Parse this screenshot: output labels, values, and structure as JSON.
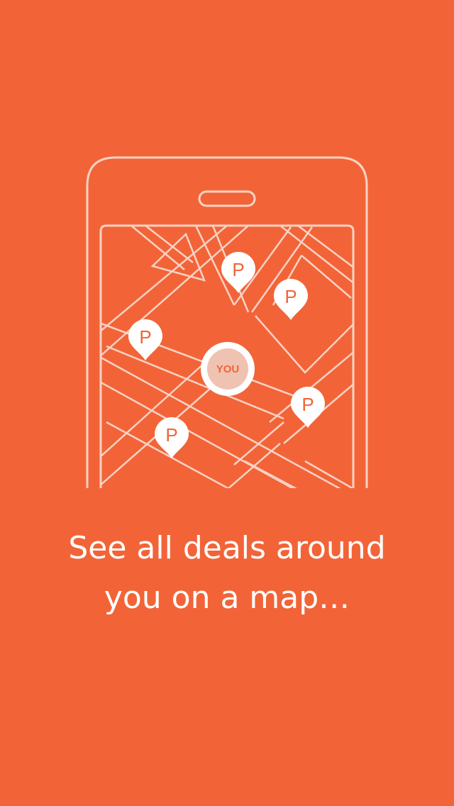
{
  "onboarding": {
    "caption_line1": "See all deals around",
    "caption_line2": "you on a map…"
  },
  "map": {
    "user_marker_label": "YOU",
    "pin_label": "P"
  },
  "colors": {
    "background": "#F26438",
    "line": "#F8D2C4",
    "pin_fill": "#FFFFFF",
    "you_fill": "#F0C2B2",
    "text": "#FFFFFF"
  }
}
